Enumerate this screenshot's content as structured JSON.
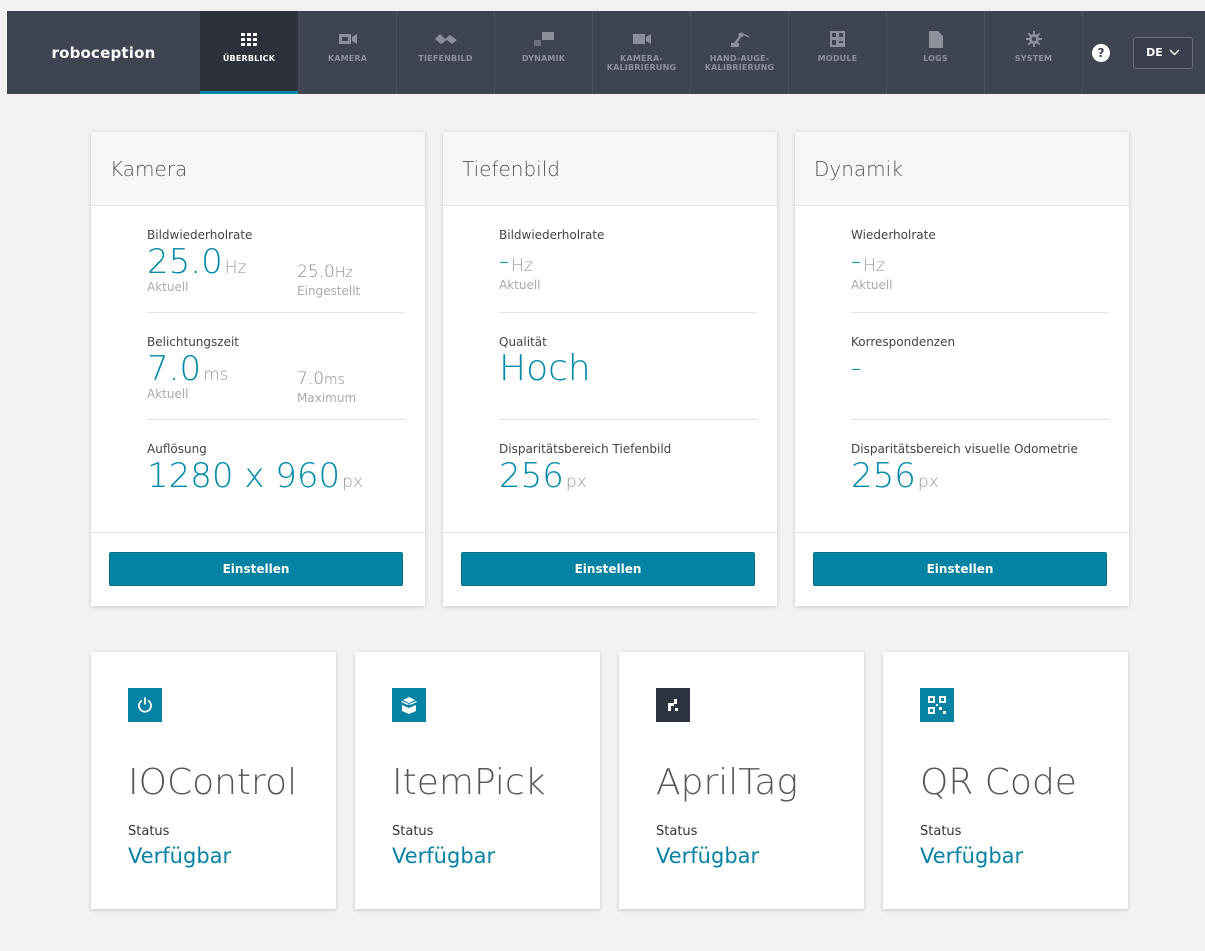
{
  "navbar": {
    "brand": "roboception",
    "items": [
      {
        "label": "ÜBERBLICK",
        "icon": "grid-icon",
        "active": true
      },
      {
        "label": "KAMERA",
        "icon": "camera-icon"
      },
      {
        "label": "TIEFENBILD",
        "icon": "depth-icon"
      },
      {
        "label": "DYNAMIK",
        "icon": "dynamics-icon"
      },
      {
        "label": "KAMERA-\nKALIBRIERUNG",
        "icon": "video-icon"
      },
      {
        "label": "HAND-AUGE-\nKALIBRIERUNG",
        "icon": "robot-arm-icon"
      },
      {
        "label": "MODULE",
        "icon": "modules-icon"
      },
      {
        "label": "LOGS",
        "icon": "file-icon"
      },
      {
        "label": "SYSTEM",
        "icon": "gear-icon"
      }
    ],
    "help": "?",
    "language": "DE"
  },
  "cards": {
    "kamera": {
      "title": "Kamera",
      "framerate_label": "Bildwiederholrate",
      "framerate_value": "25.0",
      "framerate_unit": "Hz",
      "framerate_sub": "Aktuell",
      "framerate_set_value": "25.0",
      "framerate_set_unit": "Hz",
      "framerate_set_sub": "Eingestellt",
      "exposure_label": "Belichtungszeit",
      "exposure_value": "7.0",
      "exposure_unit": "ms",
      "exposure_sub": "Aktuell",
      "exposure_max_value": "7.0",
      "exposure_max_unit": "ms",
      "exposure_max_sub": "Maximum",
      "resolution_label": "Auflösung",
      "resolution_value": "1280 x 960",
      "resolution_unit": "px",
      "button": "Einstellen"
    },
    "tiefenbild": {
      "title": "Tiefenbild",
      "framerate_label": "Bildwiederholrate",
      "framerate_value": "-",
      "framerate_unit": "Hz",
      "framerate_sub": "Aktuell",
      "quality_label": "Qualität",
      "quality_value": "Hoch",
      "disparity_label": "Disparitätsbereich Tiefenbild",
      "disparity_value": "256",
      "disparity_unit": "px",
      "button": "Einstellen"
    },
    "dynamik": {
      "title": "Dynamik",
      "rate_label": "Wiederholrate",
      "rate_value": "-",
      "rate_unit": "Hz",
      "rate_sub": "Aktuell",
      "corr_label": "Korrespondenzen",
      "corr_value": "-",
      "disparity_label": "Disparitätsbereich visuelle Odometrie",
      "disparity_value": "256",
      "disparity_unit": "px",
      "button": "Einstellen"
    }
  },
  "modules": [
    {
      "title": "IOControl",
      "icon": "power-icon",
      "status_label": "Status",
      "status": "Verfügbar"
    },
    {
      "title": "ItemPick",
      "icon": "box-icon",
      "status_label": "Status",
      "status": "Verfügbar"
    },
    {
      "title": "AprilTag",
      "icon": "apriltag-icon",
      "status_label": "Status",
      "status": "Verfügbar"
    },
    {
      "title": "QR Code",
      "icon": "qr-code-icon",
      "status_label": "Status",
      "status": "Verfügbar"
    }
  ],
  "colors": {
    "accent": "#0682a3",
    "navbar": "#3f4451",
    "active_nav": "#2d313b",
    "background": "#f2f2f2"
  }
}
